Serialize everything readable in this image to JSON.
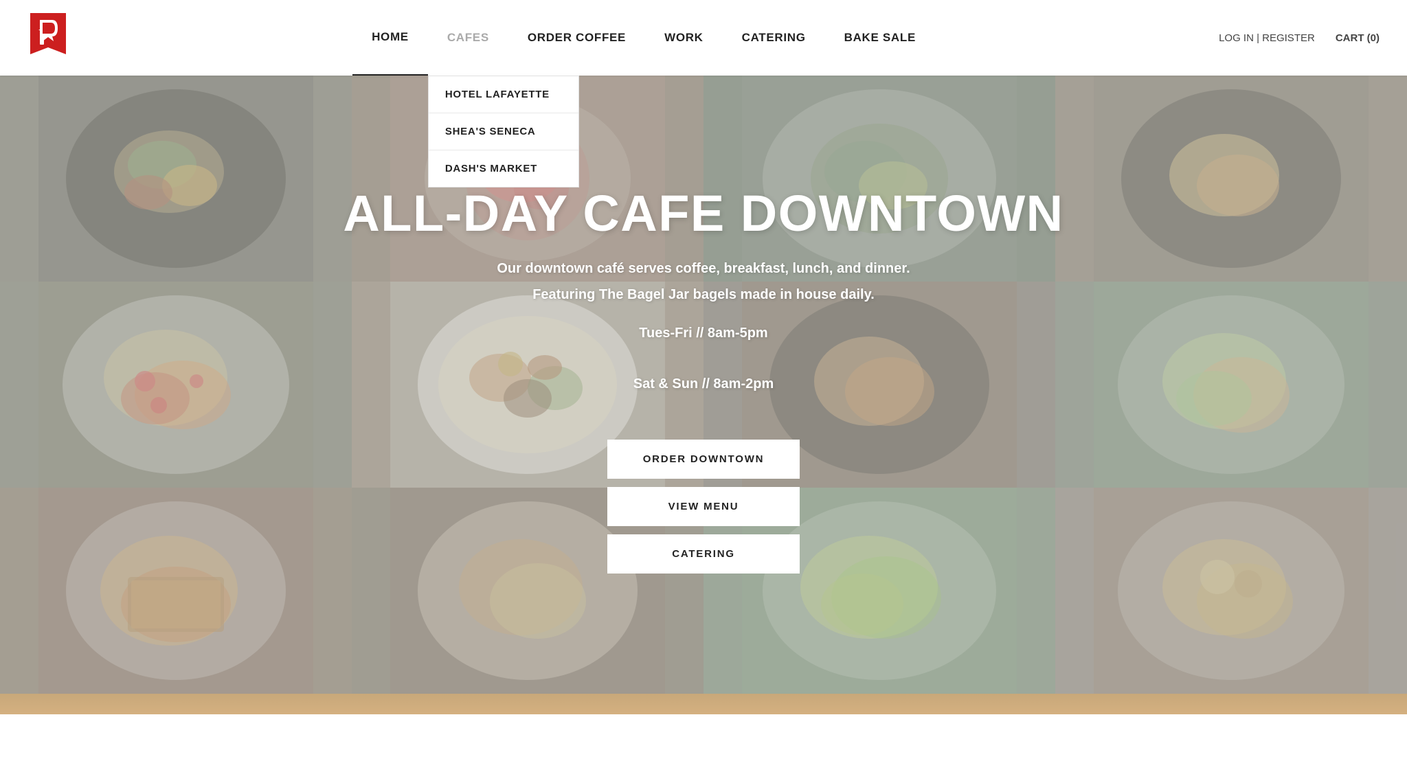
{
  "logo": {
    "letter": "P",
    "alt": "Logo"
  },
  "nav": {
    "items": [
      {
        "label": "HOME",
        "id": "home",
        "active": true
      },
      {
        "label": "CAFES",
        "id": "cafes",
        "dropdown": true
      },
      {
        "label": "ORDER COFFEE",
        "id": "order-coffee"
      },
      {
        "label": "WORK",
        "id": "work"
      },
      {
        "label": "CATERING",
        "id": "catering"
      },
      {
        "label": "BAKE SALE",
        "id": "bake-sale"
      }
    ],
    "dropdown_items": [
      {
        "label": "HOTEL LAFAYETTE",
        "id": "hotel-lafayette"
      },
      {
        "label": "SHEA'S SENECA",
        "id": "sheas-seneca"
      },
      {
        "label": "DASH'S MARKET",
        "id": "dashs-market"
      }
    ],
    "auth_label": "LOG IN | REGISTER",
    "cart_label": "CART (0)"
  },
  "hero": {
    "title": "ALL-DAY CAFE DOWNTOWN",
    "subtitle_line1": "Our downtown café serves coffee, breakfast, lunch, and dinner.",
    "subtitle_line2": "Featuring The Bagel Jar bagels made in house daily.",
    "hours_line1": "Tues-Fri // 8am-5pm",
    "hours_line2": "Sat & Sun // 8am-2pm",
    "buttons": [
      {
        "label": "ORDER DOWNTOWN",
        "id": "order-downtown"
      },
      {
        "label": "VIEW MENU",
        "id": "view-menu"
      },
      {
        "label": "CATERING",
        "id": "catering-btn"
      }
    ]
  }
}
